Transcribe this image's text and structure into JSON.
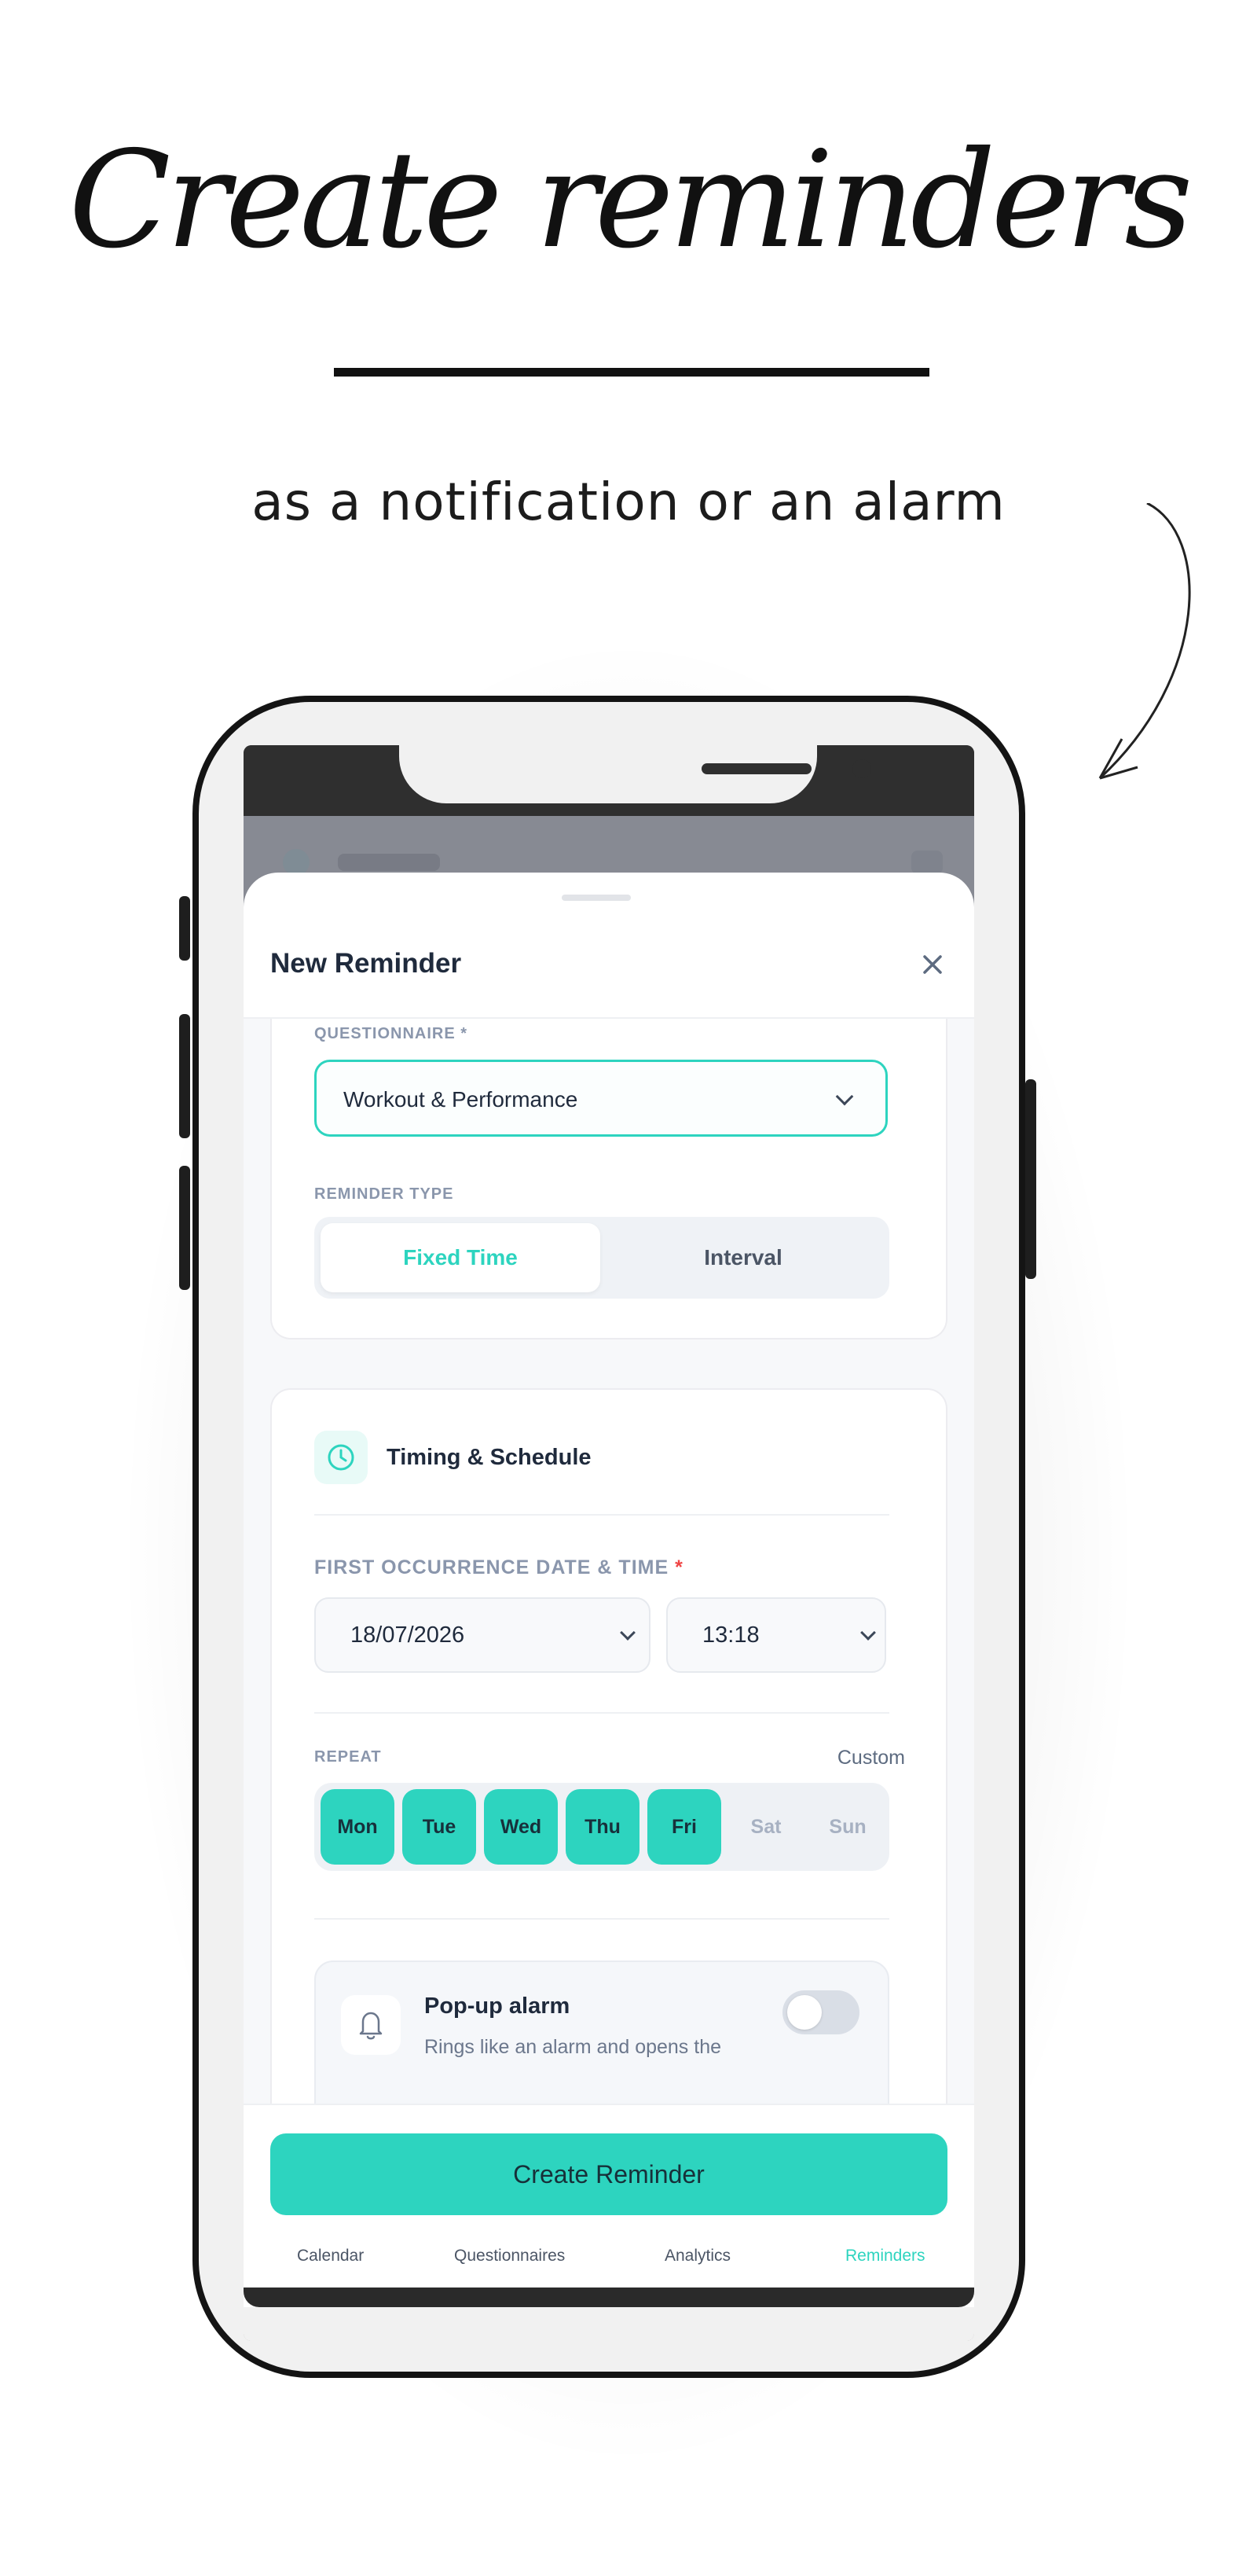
{
  "promo": {
    "headline": "Create reminders",
    "subheadline": "as a notification or an alarm"
  },
  "sheet": {
    "title": "New Reminder",
    "close_icon": "close-icon"
  },
  "questionnaire": {
    "label": "QUESTIONNAIRE",
    "required_mark": "*",
    "selected": "Workout & Performance"
  },
  "reminder_type": {
    "label": "REMINDER TYPE",
    "options": [
      "Fixed Time",
      "Interval"
    ],
    "active": "Fixed Time"
  },
  "timing": {
    "section_title": "Timing & Schedule",
    "section_icon": "clock-icon",
    "first_occurrence_label": "FIRST OCCURRENCE DATE & TIME",
    "required_mark": "*",
    "date": "18/07/2026",
    "time": "13:18"
  },
  "repeat": {
    "label": "REPEAT",
    "custom_label": "Custom",
    "days": [
      {
        "label": "Mon",
        "selected": true
      },
      {
        "label": "Tue",
        "selected": true
      },
      {
        "label": "Wed",
        "selected": true
      },
      {
        "label": "Thu",
        "selected": true
      },
      {
        "label": "Fri",
        "selected": true
      },
      {
        "label": "Sat",
        "selected": false
      },
      {
        "label": "Sun",
        "selected": false
      }
    ]
  },
  "popup_alarm": {
    "title": "Pop-up alarm",
    "description": "Rings like an alarm and opens the",
    "icon": "bell-icon",
    "enabled": false
  },
  "footer": {
    "create_label": "Create Reminder"
  },
  "tabbar": {
    "tabs": [
      "Calendar",
      "Questionnaires",
      "Analytics",
      "Reminders"
    ],
    "active": "Reminders"
  },
  "colors": {
    "accent": "#2dd4bf",
    "text_dark": "#1f2a3c",
    "label_muted": "#8a96ac",
    "required": "#ef4444"
  }
}
